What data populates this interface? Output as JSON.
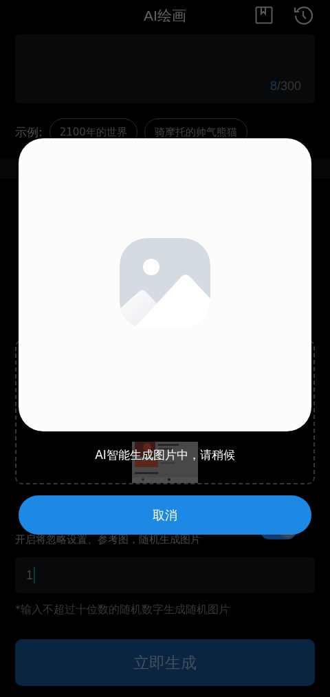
{
  "header": {
    "title": "AI绘画"
  },
  "prompt": {
    "count": "8",
    "limit": "/300"
  },
  "examples": {
    "label": "示例:",
    "chips": [
      "2100年的世界",
      "骑摩托的帅气熊猫"
    ]
  },
  "random": {
    "description": "开启将忽略设置、参考图，随机生成图片",
    "on": true
  },
  "seed": {
    "value": "1",
    "hint": "*输入不超过十位数的随机数字生成随机图片"
  },
  "generate_button": "立即生成",
  "dialog": {
    "message": "AI智能生成图片中，请稍候",
    "cancel": "取消"
  }
}
